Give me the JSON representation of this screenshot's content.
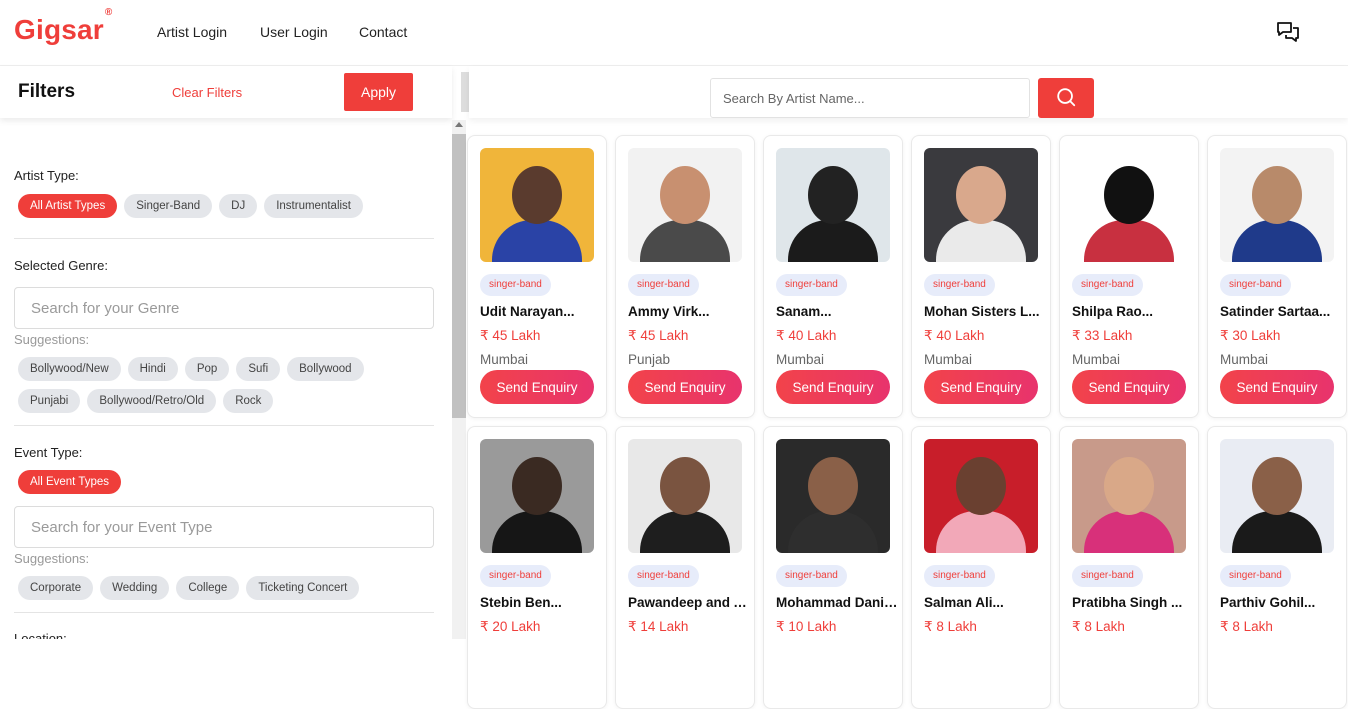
{
  "header": {
    "logo": "Gigsar",
    "logo_mark": "®",
    "nav": [
      "Artist Login",
      "User Login",
      "Contact"
    ],
    "chat_icon": "chat-bubbles-icon"
  },
  "filters": {
    "title": "Filters",
    "clear_label": "Clear Filters",
    "apply_label": "Apply",
    "artist_type": {
      "title": "Artist Type:",
      "chips": [
        "All Artist Types",
        "Singer-Band",
        "DJ",
        "Instrumentalist"
      ],
      "selected": "All Artist Types"
    },
    "genre": {
      "title": "Selected Genre:",
      "placeholder": "Search for your Genre",
      "suggestions_label": "Suggestions:",
      "row1": [
        "Bollywood/New",
        "Hindi",
        "Pop",
        "Sufi",
        "Bollywood"
      ],
      "row2": [
        "Punjabi",
        "Bollywood/Retro/Old",
        "Rock"
      ]
    },
    "event_type": {
      "title": "Event Type:",
      "chips": [
        "All Event Types"
      ],
      "placeholder": "Search for your Event Type",
      "suggestions_label": "Suggestions:",
      "suggestions": [
        "Corporate",
        "Wedding",
        "College",
        "Ticketing Concert"
      ]
    },
    "location_title": "Location:"
  },
  "search": {
    "placeholder": "Search By Artist Name...",
    "icon": "search-icon"
  },
  "colors": {
    "accent": "#ef3e3a",
    "badge_bg": "#e7ecfa",
    "chip_bg": "#e4e6ea"
  },
  "artists": [
    {
      "tag": "singer-band",
      "name": "Udit Narayan...",
      "price": "₹ 45 Lakh",
      "city": "Mumbai",
      "cta": "Send Enquiry"
    },
    {
      "tag": "singer-band",
      "name": "Ammy Virk...",
      "price": "₹ 45 Lakh",
      "city": "Punjab",
      "cta": "Send Enquiry"
    },
    {
      "tag": "singer-band",
      "name": "Sanam...",
      "price": "₹ 40 Lakh",
      "city": "Mumbai",
      "cta": "Send Enquiry"
    },
    {
      "tag": "singer-band",
      "name": "Mohan Sisters L...",
      "price": "₹ 40 Lakh",
      "city": "Mumbai",
      "cta": "Send Enquiry"
    },
    {
      "tag": "singer-band",
      "name": "Shilpa Rao...",
      "price": "₹ 33 Lakh",
      "city": "Mumbai",
      "cta": "Send Enquiry"
    },
    {
      "tag": "singer-band",
      "name": "Satinder Sartaa...",
      "price": "₹ 30 Lakh",
      "city": "Mumbai",
      "cta": "Send Enquiry"
    },
    {
      "tag": "singer-band",
      "name": "Stebin Ben...",
      "price": "₹ 20 Lakh",
      "city": "",
      "cta": ""
    },
    {
      "tag": "singer-band",
      "name": "Pawandeep and A...",
      "price": "₹ 14 Lakh",
      "city": "",
      "cta": ""
    },
    {
      "tag": "singer-band",
      "name": "Mohammad Danis...",
      "price": "₹ 10 Lakh",
      "city": "",
      "cta": ""
    },
    {
      "tag": "singer-band",
      "name": "Salman Ali...",
      "price": "₹ 8 Lakh",
      "city": "",
      "cta": ""
    },
    {
      "tag": "singer-band",
      "name": "Pratibha Singh ...",
      "price": "₹ 8 Lakh",
      "city": "",
      "cta": ""
    },
    {
      "tag": "singer-band",
      "name": "Parthiv Gohil...",
      "price": "₹ 8 Lakh",
      "city": "",
      "cta": ""
    }
  ]
}
